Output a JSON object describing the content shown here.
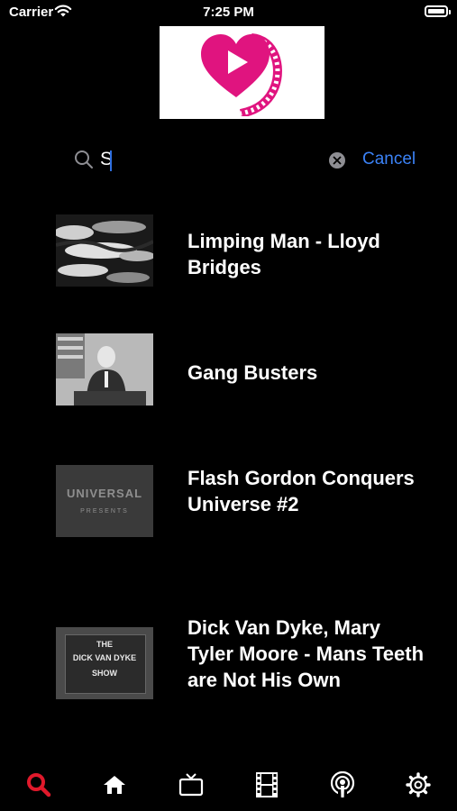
{
  "status_bar": {
    "carrier": "Carrier",
    "time": "7:25 PM"
  },
  "logo": {
    "icon": "heart-play-film-logo",
    "heart_color": "#e0147f"
  },
  "search": {
    "value": "S",
    "cancel_label": "Cancel",
    "accent_color": "#3b82f6"
  },
  "results": [
    {
      "title": "Limping Man - Lloyd Bridges",
      "thumbnail": "cloudy-sky"
    },
    {
      "title": "Gang Busters",
      "thumbnail": "man-at-desk"
    },
    {
      "title": "Flash Gordon Conquers Universe #2",
      "thumbnail": "universal-presents"
    },
    {
      "title": "Dick Van Dyke, Mary Tyler Moore - Mans Teeth are Not His Own",
      "thumbnail": "dick-van-dyke-show"
    }
  ],
  "thumbnail_text": {
    "universal": "UNIVERSAL",
    "presents": "PRESENTS",
    "show_the": "THE",
    "show_name": "DICK VAN DYKE",
    "show_word": "SHOW"
  },
  "tab_bar": {
    "active_color": "#e0192b",
    "tabs": [
      {
        "icon": "search-icon",
        "active": true
      },
      {
        "icon": "home-icon",
        "active": false
      },
      {
        "icon": "tv-icon",
        "active": false
      },
      {
        "icon": "film-icon",
        "active": false
      },
      {
        "icon": "podcast-icon",
        "active": false
      },
      {
        "icon": "gear-icon",
        "active": false
      }
    ]
  }
}
